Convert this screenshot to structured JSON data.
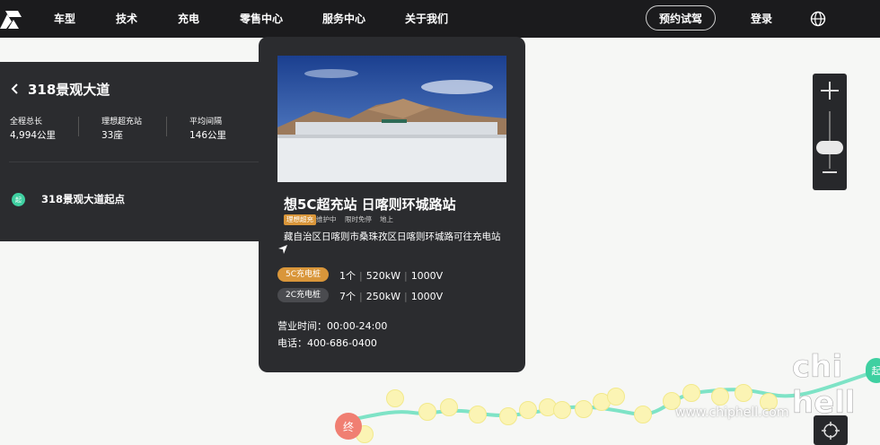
{
  "nav": {
    "items": [
      "车型",
      "技术",
      "充电",
      "零售中心",
      "服务中心",
      "关于我们"
    ],
    "test_drive": "预约试驾",
    "login": "登录"
  },
  "route": {
    "title": "318景观大道",
    "stats": [
      {
        "label": "全程总长",
        "value": "4,994公里"
      },
      {
        "label": "理想超充站",
        "value": "33座"
      },
      {
        "label": "平均间隔",
        "value": "146公里"
      }
    ],
    "start_badge": "起",
    "start_label": "318景观大道起点"
  },
  "station": {
    "name": "想5C超充站 日喀则环城路站",
    "tags": [
      "理想超充",
      "维护中",
      "限时免停",
      "地上"
    ],
    "address": "藏自治区日喀则市桑珠孜区日喀则环城路可往充电站",
    "piles": [
      {
        "type": "5C充电桩",
        "count": "1个",
        "power": "520kW",
        "voltage": "1000V",
        "color": "#d9963a"
      },
      {
        "type": "2C充电桩",
        "count": "7个",
        "power": "250kW",
        "voltage": "1000V",
        "color": "#4a4b4f"
      }
    ],
    "hours": "营业时间：00:00-24:00",
    "phone": "电话：400-686-0400"
  },
  "markers": {
    "end": "终",
    "start": "起"
  },
  "watermark": {
    "site": "www.chiphell.com"
  },
  "colors": {
    "nav_bg": "#1b1b1d",
    "panel_bg": "#2b2c2f",
    "route_green": "#7ee3c6",
    "accent_orange": "#d9963a"
  }
}
